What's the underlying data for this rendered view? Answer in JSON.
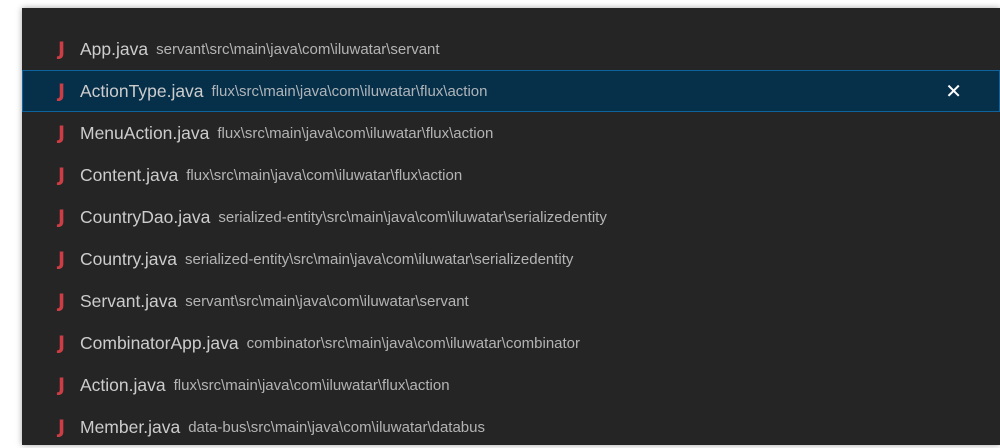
{
  "quick_open": {
    "icon_name": "java-file-icon",
    "icon_glyph": "J",
    "icon_color": "#cc3e44",
    "selected_color": "#062f4a",
    "close_glyph": "✕",
    "items": [
      {
        "name": "App.java",
        "path": "servant\\src\\main\\java\\com\\iluwatar\\servant",
        "selected": false
      },
      {
        "name": "ActionType.java",
        "path": "flux\\src\\main\\java\\com\\iluwatar\\flux\\action",
        "selected": true
      },
      {
        "name": "MenuAction.java",
        "path": "flux\\src\\main\\java\\com\\iluwatar\\flux\\action",
        "selected": false
      },
      {
        "name": "Content.java",
        "path": "flux\\src\\main\\java\\com\\iluwatar\\flux\\action",
        "selected": false
      },
      {
        "name": "CountryDao.java",
        "path": "serialized-entity\\src\\main\\java\\com\\iluwatar\\serializedentity",
        "selected": false
      },
      {
        "name": "Country.java",
        "path": "serialized-entity\\src\\main\\java\\com\\iluwatar\\serializedentity",
        "selected": false
      },
      {
        "name": "Servant.java",
        "path": "servant\\src\\main\\java\\com\\iluwatar\\servant",
        "selected": false
      },
      {
        "name": "CombinatorApp.java",
        "path": "combinator\\src\\main\\java\\com\\iluwatar\\combinator",
        "selected": false
      },
      {
        "name": "Action.java",
        "path": "flux\\src\\main\\java\\com\\iluwatar\\flux\\action",
        "selected": false
      },
      {
        "name": "Member.java",
        "path": "data-bus\\src\\main\\java\\com\\iluwatar\\databus",
        "selected": false
      }
    ]
  }
}
